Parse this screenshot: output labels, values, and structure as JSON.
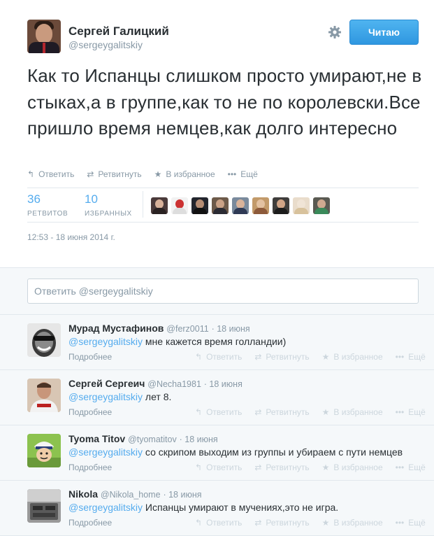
{
  "tweet": {
    "fullname": "Сергей Галицкий",
    "username": "@sergeygalitskiy",
    "follow_label": "Читаю",
    "settings_icon": "gear-icon",
    "text": "Как то Испанцы слишком просто умирают,не в стыках,а в группе,как то не по королевски.Все пришло время немцев,как долго интересно",
    "actions": {
      "reply": "Ответить",
      "retweet": "Ретвитнуть",
      "favorite": "В избранное",
      "more": "Ещё"
    },
    "stats": {
      "retweets_count": "36",
      "retweets_label": "РЕТВИТОВ",
      "favorites_count": "10",
      "favorites_label": "ИЗБРАННЫХ"
    },
    "timestamp": "12:53 - 18 июня 2014 г."
  },
  "reply_box": {
    "prefill": "Ответить @sergeygalitskiy"
  },
  "replies": [
    {
      "fullname": "Мурад Мустафинов",
      "username": "@ferz0011",
      "date": "· 18 июня",
      "mention": "@sergeygalitskiy",
      "text": " мне кажется время голландии)",
      "more": "Подробнее"
    },
    {
      "fullname": "Сергей Сергеич",
      "username": "@Necha1981",
      "date": "· 18 июня",
      "mention": "@sergeygalitskiy",
      "text": " лет 8.",
      "more": "Подробнее"
    },
    {
      "fullname": "Tyoma Titov",
      "username": "@tyomatitov",
      "date": "· 18 июня",
      "mention": "@sergeygalitskiy",
      "text": " со скрипом выходим из группы и убираем с пути немцев",
      "more": "Подробнее"
    },
    {
      "fullname": "Nikola",
      "username": "@Nikola_home",
      "date": "· 18 июня",
      "mention": "@sergeygalitskiy",
      "text": " Испанцы умирают в мучениях,это не игра.",
      "more": "Подробнее"
    }
  ],
  "reply_actions": {
    "reply": "Ответить",
    "retweet": "Ретвитнуть",
    "favorite": "В избранное",
    "more": "Ещё"
  },
  "colors": {
    "link": "#55acee",
    "muted": "#8899a6",
    "follow_button": "#2f97e0",
    "background": "#f5f8fa"
  }
}
